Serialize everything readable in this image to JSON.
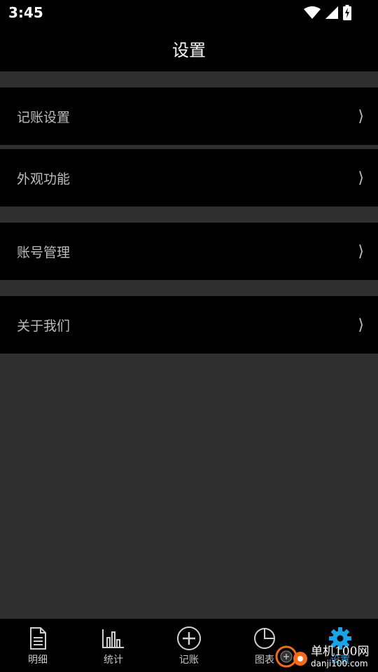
{
  "status_bar": {
    "time": "3:45",
    "icons": [
      "wifi-icon",
      "signal-icon",
      "battery-charging-icon"
    ]
  },
  "header": {
    "title": "设置"
  },
  "settings_items": [
    {
      "label": "记账设置",
      "chevron": "⟩"
    },
    {
      "label": "外观功能",
      "chevron": "⟩"
    },
    {
      "label": "账号管理",
      "chevron": "⟩"
    },
    {
      "label": "关于我们",
      "chevron": "⟩"
    }
  ],
  "tabs": [
    {
      "label": "明细",
      "icon": "document-icon",
      "active": false
    },
    {
      "label": "统计",
      "icon": "bar-chart-icon",
      "active": false
    },
    {
      "label": "记账",
      "icon": "add-circle-icon",
      "active": false
    },
    {
      "label": "图表",
      "icon": "pie-chart-icon",
      "active": false
    },
    {
      "label": "设置",
      "icon": "gear-icon",
      "active": true
    }
  ],
  "watermark": {
    "main": "单机100网",
    "sub": "danji100.com"
  },
  "colors": {
    "background": "#2f2f2f",
    "bar": "#000000",
    "text": "#bdbdbd",
    "accent": "#1aa3e8",
    "watermark_orange": "#f26b1d"
  }
}
